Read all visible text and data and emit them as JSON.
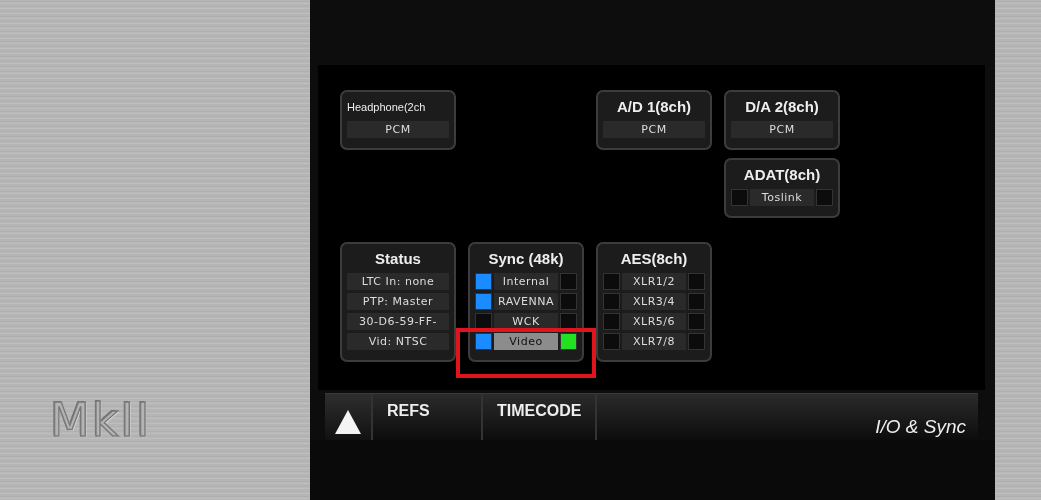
{
  "logo": "MkII",
  "modules": [
    {
      "kind": "format",
      "title": "Headphone(2ch",
      "compact": true,
      "value": "PCM"
    },
    {
      "kind": "format",
      "title": "A/D 1(8ch)",
      "compact": false,
      "value": "PCM"
    },
    {
      "kind": "format",
      "title": "D/A 2(8ch)",
      "compact": false,
      "value": "PCM"
    },
    {
      "kind": "ports",
      "title": "ADAT(8ch)",
      "rows": [
        {
          "label": "Toslink",
          "input_active": false,
          "synced": false,
          "selected": false
        }
      ]
    },
    {
      "kind": "info",
      "title": "Status",
      "lines": [
        "LTC In: none",
        "PTP: Master",
        "30-D6-59-FF-",
        "Vid: NTSC"
      ]
    },
    {
      "kind": "ports",
      "title": "Sync (48k)",
      "highlighted": true,
      "rows": [
        {
          "label": "Internal",
          "input_active": true,
          "synced": false,
          "selected": false
        },
        {
          "label": "RAVENNA",
          "input_active": true,
          "synced": false,
          "selected": false
        },
        {
          "label": "WCK",
          "input_active": false,
          "synced": false,
          "selected": false
        },
        {
          "label": "Video",
          "input_active": true,
          "synced": true,
          "selected": true
        }
      ]
    },
    {
      "kind": "ports",
      "title": "AES(8ch)",
      "rows": [
        {
          "label": "XLR1/2",
          "input_active": false,
          "synced": false,
          "selected": false
        },
        {
          "label": "XLR3/4",
          "input_active": false,
          "synced": false,
          "selected": false
        },
        {
          "label": "XLR5/6",
          "input_active": false,
          "synced": false,
          "selected": false
        },
        {
          "label": "XLR7/8",
          "input_active": false,
          "synced": false,
          "selected": false
        }
      ]
    }
  ],
  "toolbar": {
    "tabs": [
      {
        "label": "REFS",
        "selected": false
      },
      {
        "label": "TIMECODE",
        "selected": false
      }
    ],
    "page_title": "I/O & Sync"
  }
}
